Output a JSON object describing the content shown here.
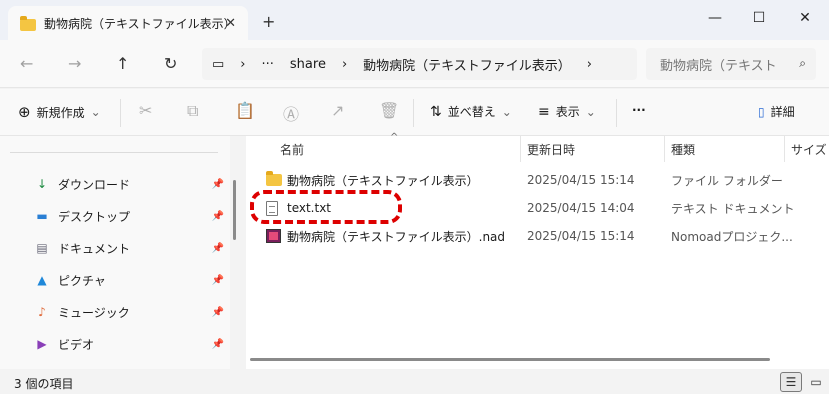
{
  "window": {
    "tab_title": "動物病院（テキストファイル表示）",
    "tab_close": "✕",
    "new_tab": "+",
    "minimize": "—",
    "maximize": "☐",
    "close": "✕"
  },
  "nav": {
    "back": "←",
    "forward": "→",
    "up": "↑",
    "refresh": "↻"
  },
  "address": {
    "computer_icon": "▭",
    "sep1": "›",
    "ellipsis": "···",
    "share": "share",
    "sep2": "›",
    "folder": "動物病院（テキストファイル表示）",
    "sep3": "›"
  },
  "search": {
    "placeholder": "動物病院（テキスト",
    "icon": "⌕"
  },
  "toolbar": {
    "new_label": "新規作成",
    "new_icon": "⊕",
    "sort_label": "並べ替え",
    "sort_icon": "⇅",
    "view_label": "表示",
    "view_icon": "≡",
    "more": "···",
    "details_label": "詳細",
    "details_icon": "▯",
    "chevron": "⌄"
  },
  "sidebar": {
    "items": [
      {
        "label": "ダウンロード",
        "icon": "download-icon",
        "glyph": "↓",
        "color": "#1a8a3f"
      },
      {
        "label": "デスクトップ",
        "icon": "desktop-icon",
        "glyph": "▬",
        "color": "#2a7fd4"
      },
      {
        "label": "ドキュメント",
        "icon": "document-icon",
        "glyph": "▤",
        "color": "#6a6a7a"
      },
      {
        "label": "ピクチャ",
        "icon": "pictures-icon",
        "glyph": "▲",
        "color": "#1f88d9"
      },
      {
        "label": "ミュージック",
        "icon": "music-icon",
        "glyph": "♪",
        "color": "#e06a3a"
      },
      {
        "label": "ビデオ",
        "icon": "video-icon",
        "glyph": "▶",
        "color": "#8a3fb8"
      }
    ],
    "pin": "📌"
  },
  "columns": {
    "name": "名前",
    "date": "更新日時",
    "type": "種類",
    "size": "サイズ",
    "sort_caret": "^"
  },
  "files": [
    {
      "name": "動物病院（テキストファイル表示）",
      "date": "2025/04/15 15:14",
      "type": "ファイル フォルダー",
      "icon": "folder-icon"
    },
    {
      "name": "text.txt",
      "date": "2025/04/15 14:04",
      "type": "テキスト ドキュメント",
      "icon": "text-file-icon"
    },
    {
      "name": "動物病院（テキストファイル表示）.nad",
      "date": "2025/04/15 15:14",
      "type": "Nomoadプロジェク...",
      "icon": "nad-file-icon"
    }
  ],
  "status": {
    "item_count": "3 個の項目",
    "details_view": "☰",
    "tiles_view": "▭"
  },
  "colors": {
    "highlight": "#dd0000",
    "folder": "#f4c542"
  }
}
